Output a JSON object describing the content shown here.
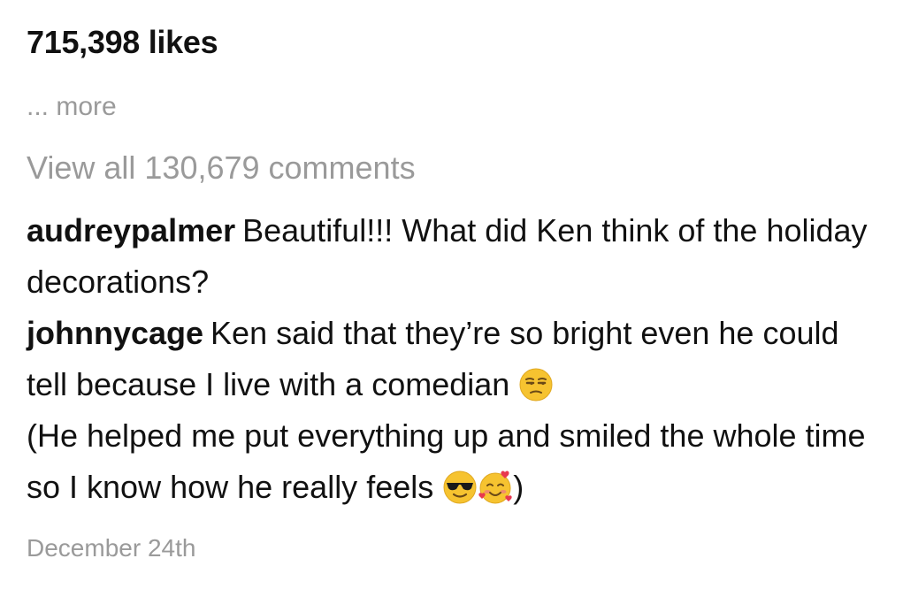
{
  "post": {
    "likes_text": "715,398 likes",
    "more_text": "... more",
    "view_all_text": "View all 130,679 comments",
    "date_text": "December 24th"
  },
  "comments": [
    {
      "username": "audreypalmer",
      "text": "Beautiful!!! What did Ken think of the holiday decorations?"
    },
    {
      "username": "johnnycage",
      "text_part1": "Ken said that they’re so bright even he could tell because I live with a comedian",
      "emoji1": "unamused-face-icon",
      "line_break_text": "(He helped me put everything up and smiled the whole time so I know how he really feels",
      "emoji2": "sunglasses-face-icon",
      "emoji3": "smiling-face-with-hearts-icon",
      "text_end": ")"
    }
  ],
  "colors": {
    "text": "#111111",
    "secondary_text": "#9a9a9a",
    "emoji_yellow": "#f6c330",
    "heart_red": "#e8384f"
  }
}
